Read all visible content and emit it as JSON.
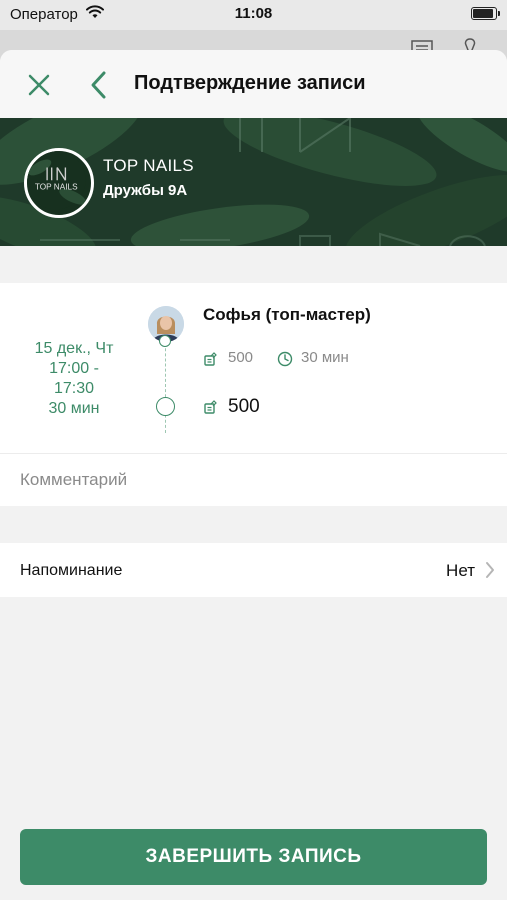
{
  "status_bar": {
    "carrier": "Оператор",
    "time": "11:08"
  },
  "nav": {
    "title": "Подтверждение записи"
  },
  "salon": {
    "name": "TOP NAILS",
    "address": "Дружбы 9А",
    "logo_text": "TOP NAILS"
  },
  "appointment": {
    "date": "15 дек., Чт",
    "time_range": "17:00 -\n17:30",
    "duration": "30 мин",
    "master_name": "Софья (топ-мастер)",
    "service_price": "500",
    "service_duration": "30 мин",
    "total_price": "500"
  },
  "comment": {
    "placeholder": "Комментарий",
    "value": ""
  },
  "reminder": {
    "label": "Напоминание",
    "value": "Нет"
  },
  "confirm_button": {
    "label": "ЗАВЕРШИТЬ ЗАПИСЬ"
  },
  "colors": {
    "accent": "#3d8b68",
    "hero_bg": "#1f3a2a",
    "muted_text": "#8a8a8a"
  },
  "icons": [
    "wifi-icon",
    "battery-icon",
    "close-icon",
    "back-icon",
    "price-icon",
    "clock-icon",
    "chevron-right-icon"
  ]
}
